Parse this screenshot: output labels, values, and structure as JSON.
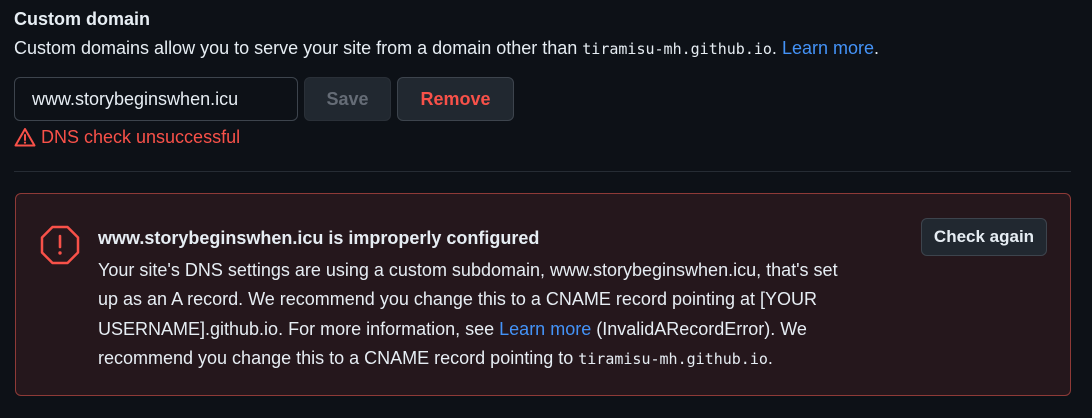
{
  "section": {
    "title": "Custom domain",
    "description_prefix": "Custom domains allow you to serve your site from a domain other than ",
    "default_domain": "tiramisu-mh.github.io",
    "description_suffix": ".",
    "learn_more": "Learn more",
    "learn_more_suffix": "."
  },
  "form": {
    "domain_value": "www.storybeginswhen.icu",
    "save_label": "Save",
    "remove_label": "Remove"
  },
  "dns_status": {
    "icon": "alert-triangle-icon",
    "text": "DNS check unsuccessful",
    "color": "#f85149"
  },
  "alert": {
    "icon": "stop-octagon-icon",
    "heading": "www.storybeginswhen.icu is improperly configured",
    "line1": "Your site's DNS settings are using a custom subdomain, www.storybeginswhen.icu, that's set",
    "line2": "up as an A record. We recommend you change this to a CNAME record pointing at [YOUR",
    "line3_prefix": "USERNAME].github.io. For more information, see ",
    "line3_link": "Learn more",
    "line3_suffix": " (InvalidARecordError). We",
    "line4_prefix": "recommend you change this to a CNAME record pointing to ",
    "line4_code": "tiramisu-mh.github.io",
    "line4_suffix": ".",
    "check_again_label": "Check again"
  },
  "colors": {
    "background": "#0d1117",
    "text": "#e6edf3",
    "link": "#4493f8",
    "danger": "#f85149",
    "alert_bg": "#25171c",
    "alert_border": "#8e3a37",
    "button_bg": "#212830"
  }
}
